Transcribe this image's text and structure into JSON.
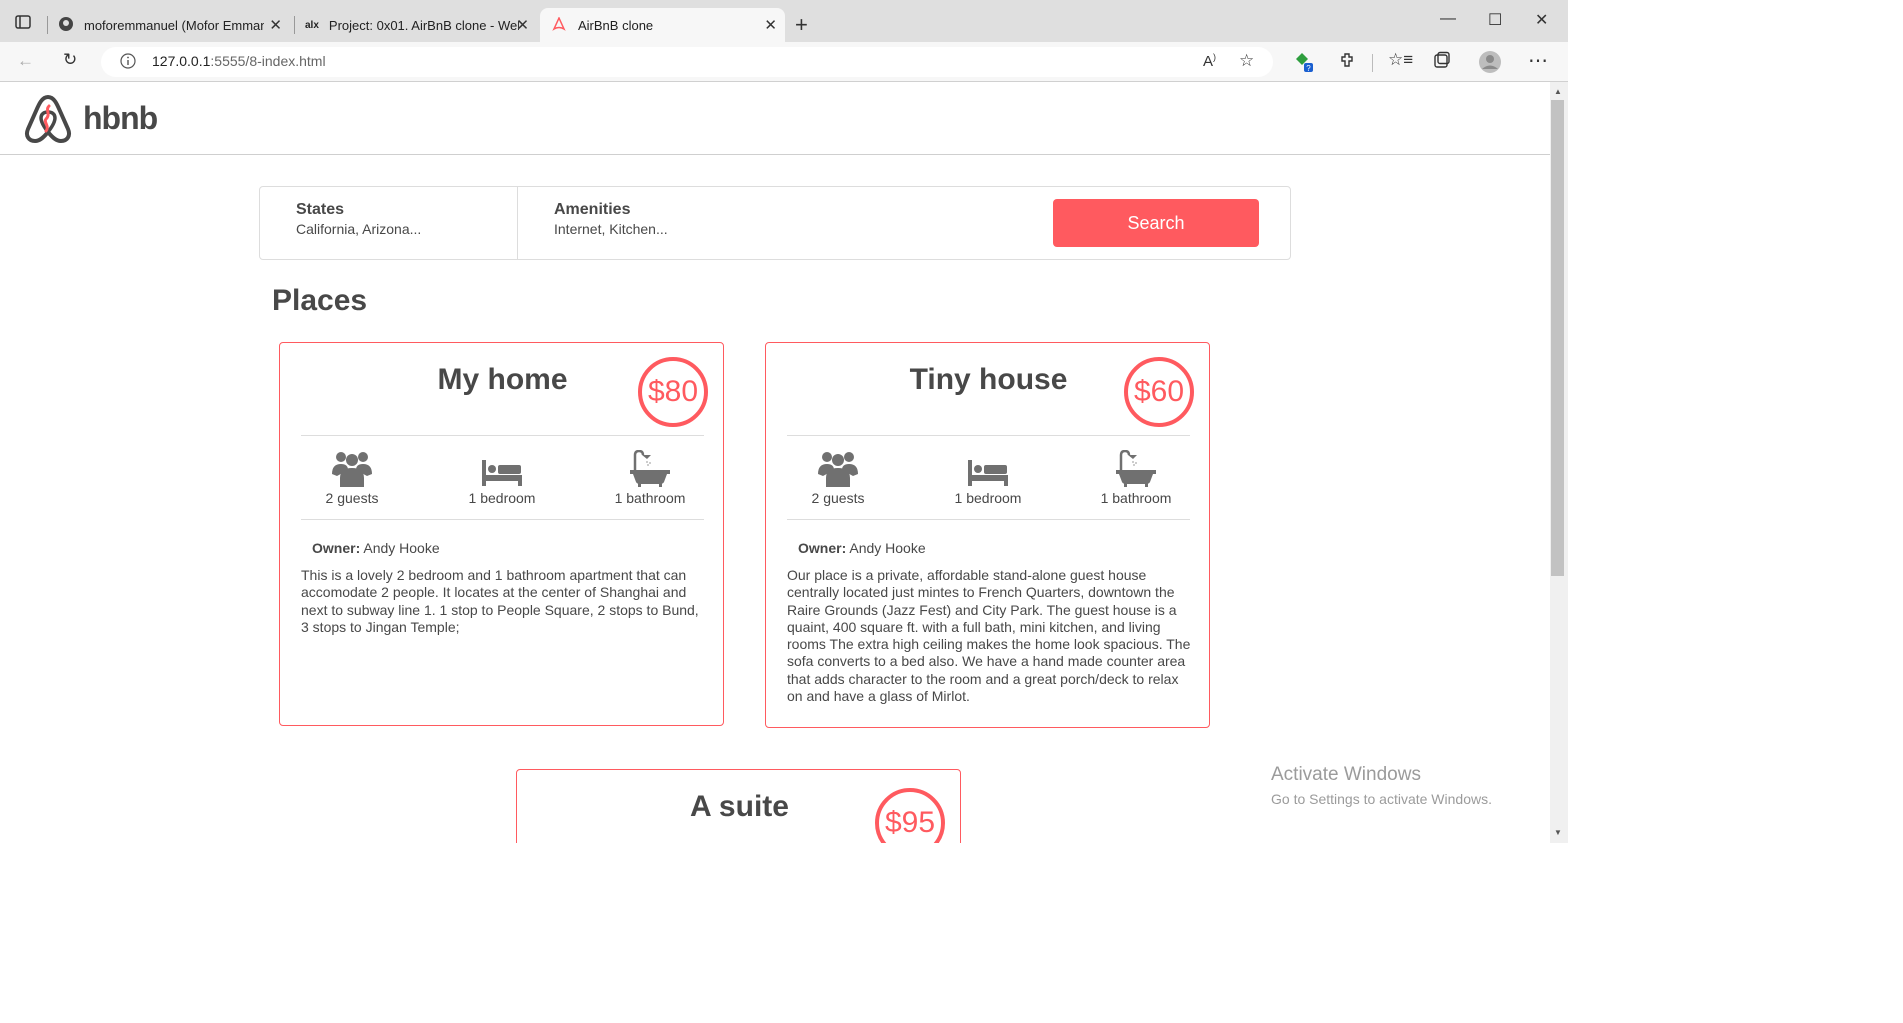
{
  "browser": {
    "tabs": [
      {
        "label": "moforemmanuel (Mofor Emman",
        "active": false
      },
      {
        "label": "Project: 0x01. AirBnB clone - Wel",
        "active": false
      },
      {
        "label": "AirBnB clone",
        "active": true
      }
    ],
    "url_host": "127.0.0.1",
    "url_rest": ":5555/8-index.html"
  },
  "header": {
    "logo_text": "hbnb"
  },
  "filters": {
    "states": {
      "title": "States",
      "value": "California, Arizona..."
    },
    "amenities": {
      "title": "Amenities",
      "value": "Internet, Kitchen..."
    },
    "search_label": "Search"
  },
  "places": {
    "title": "Places",
    "items": [
      {
        "name": "My home",
        "price": "$80",
        "guests": "2 guests",
        "rooms": "1 bedroom",
        "bathrooms": "1 bathroom",
        "owner_label": "Owner:",
        "owner": " Andy Hooke",
        "description": "This is a lovely 2 bedroom and 1 bathroom apartment that can accomodate 2 people. It locates at the center of Shanghai and next to subway line 1. 1 stop to People Square, 2 stops to Bund, 3 stops to Jingan Temple;"
      },
      {
        "name": "Tiny house",
        "price": "$60",
        "guests": "2 guests",
        "rooms": "1 bedroom",
        "bathrooms": "1 bathroom",
        "owner_label": "Owner:",
        "owner": " Andy Hooke",
        "description": "Our place is a private, affordable stand-alone guest house centrally located just mintes to French Quarters, downtown the Raire Grounds (Jazz Fest) and City Park. The guest house is a quaint, 400 square ft. with a full bath, mini kitchen, and living rooms The extra high ceiling makes the home look spacious. The sofa converts to a bed also. We have a hand made counter area that adds character to the room and a great porch/deck to relax on and have a glass of Mirlot."
      },
      {
        "name": "A suite",
        "price": "$95"
      }
    ]
  },
  "watermark": {
    "line1": "Activate Windows",
    "line2": "Go to Settings to activate Windows."
  },
  "colors": {
    "accent": "#ff5a5f",
    "text": "#484848",
    "border": "#dddddd"
  }
}
